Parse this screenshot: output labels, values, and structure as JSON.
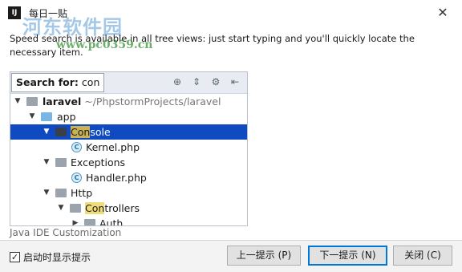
{
  "window": {
    "title": "每日一贴",
    "app_icon": "IJ",
    "close_label": "✕"
  },
  "watermark": {
    "brand": "河东软件园",
    "url": "www.pc0359.cn"
  },
  "tip_text": "Speed search is available in all tree views: just start typing and you'll quickly locate the necessary item.",
  "speed_search": {
    "label": "Search for:",
    "query": "con"
  },
  "tree": {
    "rows": [
      {
        "name": "laravel",
        "path": "~/PhpstormProjects/laravel"
      },
      {
        "name": "app"
      },
      {
        "match": "Con",
        "rest": "sole"
      },
      {
        "name": "Kernel.php"
      },
      {
        "name": "Exceptions"
      },
      {
        "name": "Handler.php"
      },
      {
        "name": "Http"
      },
      {
        "match": "Con",
        "rest": "trollers"
      },
      {
        "name": "Auth"
      }
    ]
  },
  "section_label": "Java IDE Customization",
  "footer": {
    "checkbox_label": "启动时显示提示",
    "checkbox_checked": "✓",
    "prev_button": "上一提示 (P)",
    "next_button": "下一提示 (N)",
    "close_button": "关闭 (C)"
  },
  "colors": {
    "selection": "#0f4ac0",
    "highlight": "#f1dc7a",
    "accent": "#0078d7"
  }
}
